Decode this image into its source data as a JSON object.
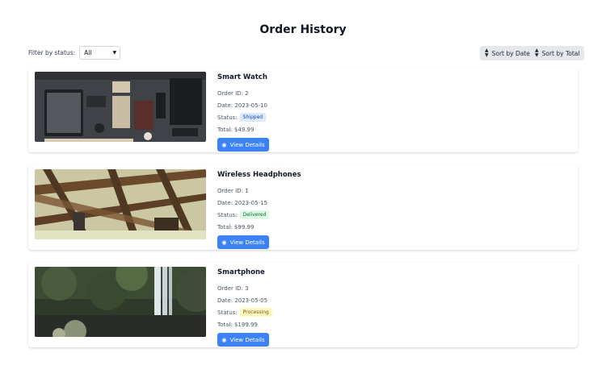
{
  "page": {
    "title": "Order History"
  },
  "filter": {
    "label": "Filter by status:",
    "selected": "All"
  },
  "sort": {
    "by_date": "Sort by Date",
    "by_total": "Sort by Total"
  },
  "orders": [
    {
      "name": "Smart Watch",
      "order_id": "Order ID: 2",
      "date": "Date: 2023-05-10",
      "status_label": "Status:",
      "status": "Shipped",
      "status_color": "#dbeafe",
      "status_text_color": "#1e40af",
      "total": "Total: $49.99",
      "button": "View Details"
    },
    {
      "name": "Wireless Headphones",
      "order_id": "Order ID: 1",
      "date": "Date: 2023-05-15",
      "status_label": "Status:",
      "status": "Delivered",
      "status_color": "#dcfce7",
      "status_text_color": "#166534",
      "total": "Total: $99.99",
      "button": "View Details"
    },
    {
      "name": "Smartphone",
      "order_id": "Order ID: 3",
      "date": "Date: 2023-05-05",
      "status_label": "Status:",
      "status": "Processing",
      "status_color": "#fef9c3",
      "status_text_color": "#854d0e",
      "total": "Total: $199.99",
      "button": "View Details"
    }
  ]
}
